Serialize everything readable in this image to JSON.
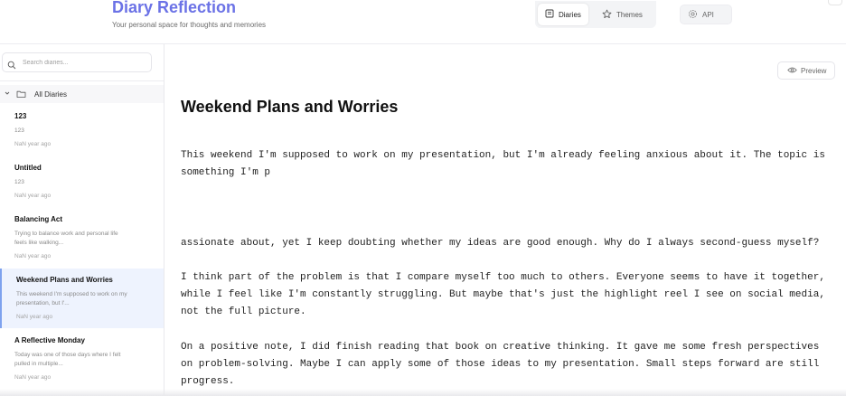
{
  "header": {
    "app_title": "Diary Reflection",
    "subtitle": "Your personal space for thoughts and memories",
    "tabs": [
      {
        "label": "Diaries",
        "icon": "book-icon",
        "active": true
      },
      {
        "label": "Themes",
        "icon": "star-icon",
        "active": false
      }
    ],
    "api_label": "API"
  },
  "sidebar": {
    "search_placeholder": "Search diaries...",
    "folder_label": "All Diaries",
    "entries": [
      {
        "title": "123",
        "preview": "123",
        "date": "NaN year ago"
      },
      {
        "title": "Untitled",
        "preview": "123",
        "date": "NaN year ago"
      },
      {
        "title": "Balancing Act",
        "preview": "Trying to balance work and personal life feels like walking...",
        "date": "NaN year ago"
      },
      {
        "title": "Weekend Plans and Worries",
        "preview": "This weekend I'm supposed to work on my presentation, but I'...",
        "date": "NaN year ago",
        "active": true
      },
      {
        "title": "A Reflective Monday",
        "preview": "Today was one of those days where I felt pulled in multiple...",
        "date": "NaN year ago"
      }
    ]
  },
  "main": {
    "preview_label": "Preview",
    "title": "Weekend Plans and Worries",
    "paragraphs": [
      "This weekend I'm supposed to work on my presentation, but I'm already feeling anxious about it. The topic is something I'm p",
      "assionate about, yet I keep doubting whether my ideas are good enough. Why do I always second-guess myself?",
      "I think part of the problem is that I compare myself too much to others. Everyone seems to have it together, while I feel like I'm constantly struggling. But maybe that's just the highlight reel I see on social media, not the full picture.",
      "On a positive note, I did finish reading that book on creative thinking. It gave me some fresh perspectives on problem-solving. Maybe I can apply some of those ideas to my presentation. Small steps forward are still progress."
    ]
  },
  "colors": {
    "brand": "#6b72e6",
    "active_entry_bg": "#eef3fe",
    "active_entry_border": "#7ea2ee"
  }
}
